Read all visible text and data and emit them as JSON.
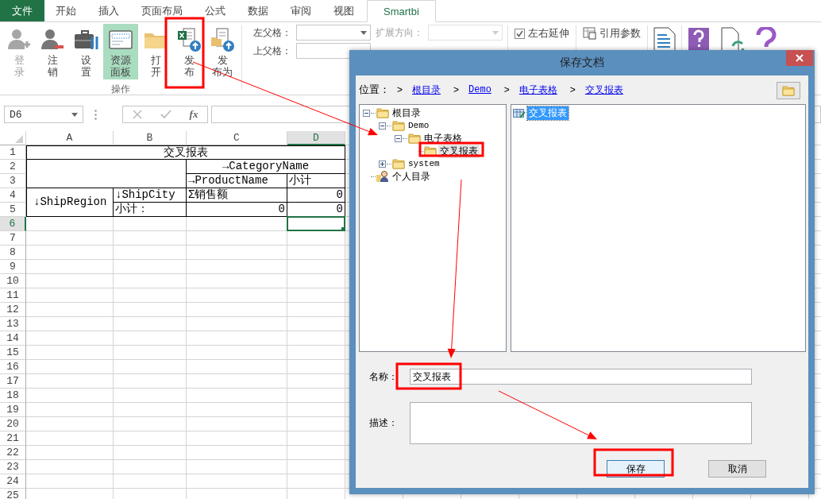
{
  "ribbon_tabs": [
    {
      "label": "文件",
      "kind": "file",
      "selected": false
    },
    {
      "label": "开始",
      "kind": "tab",
      "selected": false
    },
    {
      "label": "插入",
      "kind": "tab",
      "selected": false
    },
    {
      "label": "页面布局",
      "kind": "tab",
      "selected": false
    },
    {
      "label": "公式",
      "kind": "tab",
      "selected": false
    },
    {
      "label": "数据",
      "kind": "tab",
      "selected": false
    },
    {
      "label": "审阅",
      "kind": "tab",
      "selected": false
    },
    {
      "label": "视图",
      "kind": "tab",
      "selected": false
    },
    {
      "label": "Smartbi",
      "kind": "tab",
      "selected": true
    }
  ],
  "ribbon": {
    "group_label": "操作",
    "buttons": [
      {
        "label": "登录",
        "kind": "login",
        "disabled": true,
        "selected": false
      },
      {
        "label": "注销",
        "kind": "logout",
        "disabled": false,
        "selected": false
      },
      {
        "label": "设置",
        "kind": "settings",
        "disabled": false,
        "selected": false
      },
      {
        "label": "资源面板",
        "kind": "panel",
        "disabled": false,
        "selected": true
      },
      {
        "label": "打开",
        "kind": "open",
        "disabled": false,
        "selected": false
      },
      {
        "label": "发布",
        "kind": "publish",
        "disabled": false,
        "selected": false
      },
      {
        "label": "发布为",
        "kind": "publish_as",
        "disabled": false,
        "selected": false
      }
    ],
    "fields": [
      {
        "label": "左父格：",
        "kind": "dropdown",
        "disabled": false
      },
      {
        "label": "扩展方向：",
        "kind": "dropdown",
        "disabled": true
      },
      {
        "label": "上父格：",
        "kind": "text",
        "disabled": false
      }
    ],
    "checkboxes": [
      {
        "label": "左右延伸",
        "checked": true
      }
    ],
    "param_buttons": [
      {
        "label": "引用参数",
        "kind": "insert"
      }
    ]
  },
  "formula_bar": {
    "name_box": "D6",
    "function_label": "fx"
  },
  "sheet": {
    "columns": [
      {
        "label": "A",
        "selected": false
      },
      {
        "label": "B",
        "selected": false
      },
      {
        "label": "C",
        "selected": false
      },
      {
        "label": "D",
        "selected": true
      }
    ],
    "rows": [
      {
        "label": "1",
        "selected": false
      },
      {
        "label": "2",
        "selected": false
      },
      {
        "label": "3",
        "selected": false
      },
      {
        "label": "4",
        "selected": false
      },
      {
        "label": "5",
        "selected": false
      },
      {
        "label": "6",
        "selected": true
      },
      {
        "label": "7",
        "selected": false
      },
      {
        "label": "8",
        "selected": false
      },
      {
        "label": "9",
        "selected": false
      },
      {
        "label": "10",
        "selected": false
      },
      {
        "label": "11",
        "selected": false
      },
      {
        "label": "12",
        "selected": false
      },
      {
        "label": "13",
        "selected": false
      },
      {
        "label": "14",
        "selected": false
      },
      {
        "label": "15",
        "selected": false
      },
      {
        "label": "16",
        "selected": false
      },
      {
        "label": "17",
        "selected": false
      },
      {
        "label": "18",
        "selected": false
      },
      {
        "label": "19",
        "selected": false
      },
      {
        "label": "20",
        "selected": false
      },
      {
        "label": "21",
        "selected": false
      },
      {
        "label": "22",
        "selected": false
      },
      {
        "label": "23",
        "selected": false
      },
      {
        "label": "24",
        "selected": false
      },
      {
        "label": "25",
        "selected": false
      }
    ],
    "report_rows": [
      [
        {
          "kind": "title",
          "text": "交叉报表"
        },
        {
          "kind": "span_left"
        },
        {
          "kind": "span_left"
        },
        {
          "kind": "span_left"
        }
      ],
      [
        {
          "kind": "blank"
        },
        {
          "kind": "span_left"
        },
        {
          "kind": "title",
          "text": "→CategoryName"
        },
        {
          "kind": "span_left"
        }
      ],
      [
        {
          "kind": "span_up"
        },
        {
          "kind": "span_diag"
        },
        {
          "kind": "text",
          "text": "→ProductName"
        },
        {
          "kind": "text",
          "text": "小计"
        }
      ],
      [
        {
          "kind": "label",
          "text": "↓ShipRegion"
        },
        {
          "kind": "text",
          "text": "↓ShipCity"
        },
        {
          "kind": "text",
          "text": "Σ销售额"
        },
        {
          "kind": "number",
          "text": "0"
        }
      ],
      [
        {
          "kind": "span_up"
        },
        {
          "kind": "text",
          "text": "小计："
        },
        {
          "kind": "number",
          "text": "0"
        },
        {
          "kind": "number",
          "text": "0"
        }
      ]
    ]
  },
  "dialog": {
    "title": "保存文档",
    "location_label": "位置：",
    "breadcrumb": [
      {
        "separator": ">",
        "label": "根目录"
      },
      {
        "separator": ">",
        "label": "Demo"
      },
      {
        "separator": ">",
        "label": "电子表格"
      },
      {
        "separator": ">",
        "label": "交叉报表"
      }
    ],
    "tree": [
      {
        "label": "根目录",
        "kind": "folder",
        "expanded": true,
        "selected": false,
        "children": [
          {
            "label": "Demo",
            "kind": "folder",
            "expanded": true,
            "selected": false,
            "children": [
              {
                "label": "电子表格",
                "kind": "folder",
                "expanded": true,
                "selected": false,
                "children": [
                  {
                    "label": "交叉报表",
                    "kind": "folder",
                    "selected": true
                  }
                ]
              }
            ]
          },
          {
            "label": "system",
            "kind": "folder",
            "expanded": false,
            "selected": false
          }
        ]
      },
      {
        "label": "个人目录",
        "kind": "user",
        "selected": false
      }
    ],
    "files": [
      {
        "label": "交叉报表",
        "selected": true
      }
    ],
    "name_label": "名称：",
    "name_value": "交叉报表",
    "description_label": "描述：",
    "buttons": [
      {
        "label": "保存",
        "kind": "primary"
      },
      {
        "label": "取消",
        "kind": "secondary"
      }
    ]
  }
}
